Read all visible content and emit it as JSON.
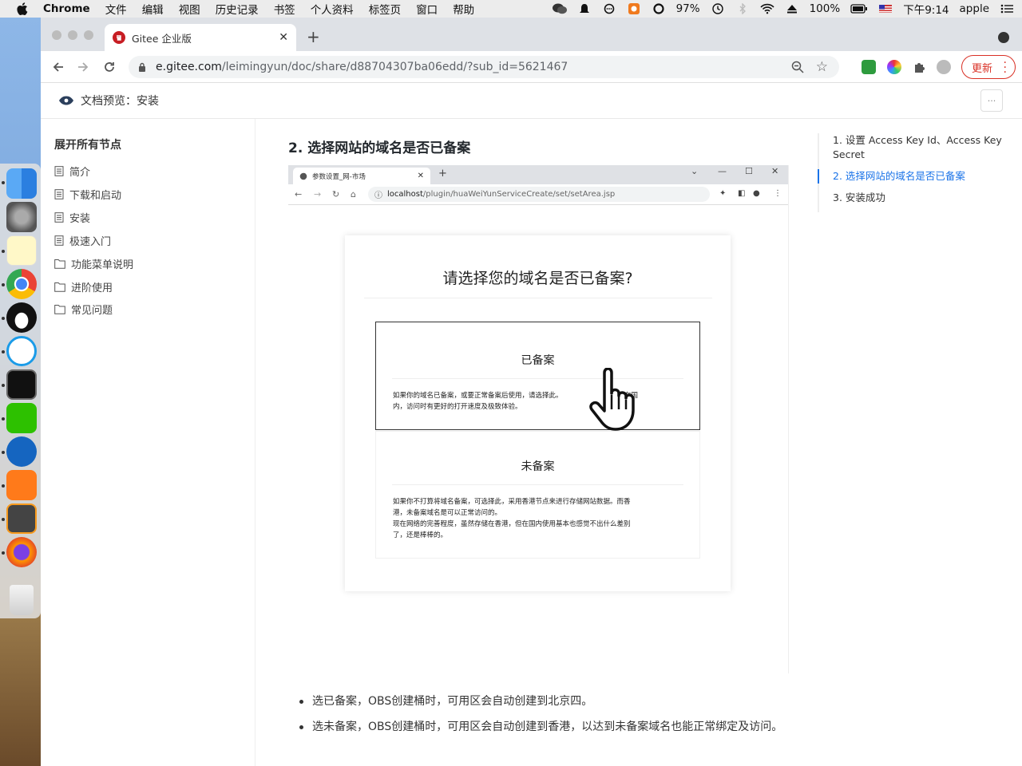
{
  "menubar": {
    "app": "Chrome",
    "items": [
      "文件",
      "编辑",
      "视图",
      "历史记录",
      "书签",
      "个人资料",
      "标签页",
      "窗口",
      "帮助"
    ],
    "battery": "97%",
    "battery2": "100%",
    "time": "下午9:14",
    "user": "apple"
  },
  "browser": {
    "tab_title": "Gitee 企业版",
    "url_host": "e.gitee.com",
    "url_path": "/leimingyun/doc/share/d88704307ba06edd/?sub_id=5621467",
    "update_label": "更新"
  },
  "doc_header": {
    "title": "文档预览：安装"
  },
  "sidebar": {
    "expand_label": "展开所有节点",
    "items": [
      {
        "label": "简介",
        "icon": "doc-icon"
      },
      {
        "label": "下载和启动",
        "icon": "doc-icon"
      },
      {
        "label": "安装",
        "icon": "doc-icon"
      },
      {
        "label": "极速入门",
        "icon": "doc-icon"
      },
      {
        "label": "功能菜单说明",
        "icon": "folder-icon"
      },
      {
        "label": "进阶使用",
        "icon": "folder-icon"
      },
      {
        "label": "常见问题",
        "icon": "folder-icon"
      }
    ]
  },
  "main": {
    "heading": "2. 选择网站的域名是否已备案",
    "screenshot": {
      "tab_title": "参数设置_网-市场",
      "url_key": "localhost",
      "url_rest": "/plugin/huaWeiYunServiceCreate/set/setArea.jsp",
      "question": "请选择您的域名是否已备案?",
      "option1_title": "已备案",
      "option1_desc_a": "如果你的域名已备案，或要正常备案后使用，请选择此。",
      "option1_desc_b": "件存储在国",
      "option1_desc_c": "内，访问时有更好的打开速度及极致体验。",
      "option2_title": "未备案",
      "option2_desc_1": "如果你不打算将域名备案，可选择此，采用香港节点来进行存储网站数据。而香",
      "option2_desc_2": "港，未备案域名是可以正常访问的。",
      "option2_desc_3": "现在网络的完善程度，虽然存储在香港，但在国内使用基本也感觉不出什么差别",
      "option2_desc_4": "了，还是棒棒的。"
    },
    "bullets": [
      "选已备案，OBS创建桶时，可用区会自动创建到北京四。",
      "选未备案，OBS创建桶时，可用区会自动创建到香港，以达到未备案域名也能正常绑定及访问。"
    ]
  },
  "toc": {
    "items": [
      {
        "label": "1. 设置 Access Key Id、Access Key Secret"
      },
      {
        "label": "2. 选择网站的域名是否已备案"
      },
      {
        "label": "3. 安装成功"
      }
    ]
  },
  "colors": {
    "accent": "#1a73e8",
    "gitee_red": "#c71d23",
    "update_red": "#d93025"
  }
}
